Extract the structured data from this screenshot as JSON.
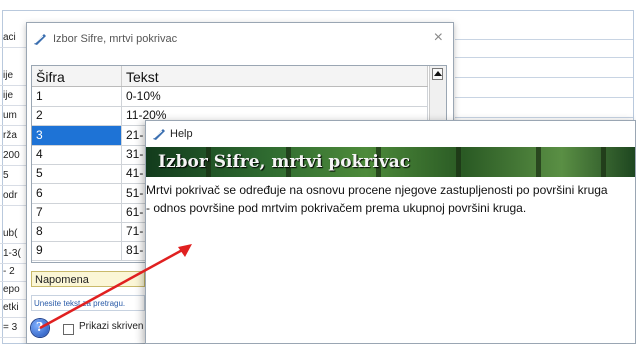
{
  "background_window": {
    "row_labels": [
      "aci",
      "ije",
      "ije",
      "um",
      "rža",
      "200",
      "5",
      "odr",
      "ub(",
      "1-3(",
      "- 2",
      "epo",
      "etki",
      "= 3"
    ]
  },
  "dialog": {
    "title": "Izbor Sifre, mrtvi pokrivac",
    "close_glyph": "×",
    "table": {
      "columns": [
        "Šifra",
        "Tekst"
      ],
      "rows": [
        {
          "sifra": "1",
          "tekst": "0-10%"
        },
        {
          "sifra": "2",
          "tekst": "11-20%"
        },
        {
          "sifra": "3",
          "tekst": "21-"
        },
        {
          "sifra": "4",
          "tekst": "31-"
        },
        {
          "sifra": "5",
          "tekst": "41-"
        },
        {
          "sifra": "6",
          "tekst": "51-"
        },
        {
          "sifra": "7",
          "tekst": "61-"
        },
        {
          "sifra": "8",
          "tekst": "71-"
        },
        {
          "sifra": "9",
          "tekst": "81-"
        }
      ],
      "selected_index": 2
    },
    "napomena_label": "Napomena",
    "search_placeholder": "Unesite tekst za pretragu.",
    "help_icon": "?",
    "show_hidden_label": "Prikazi skriven"
  },
  "help_window": {
    "title": "Help",
    "banner_title": "Izbor Sifre, mrtvi pokrivac",
    "body_line1": "Mrtvi pokrivač se određuje na osnovu procene njegove zastupljenosti po površini kruga",
    "body_line2": "- odnos površine pod mrtvim pokrivačem prema ukupnoj površini kruga."
  },
  "colors": {
    "selection": "#1e73d6",
    "arrow": "#e02020"
  }
}
